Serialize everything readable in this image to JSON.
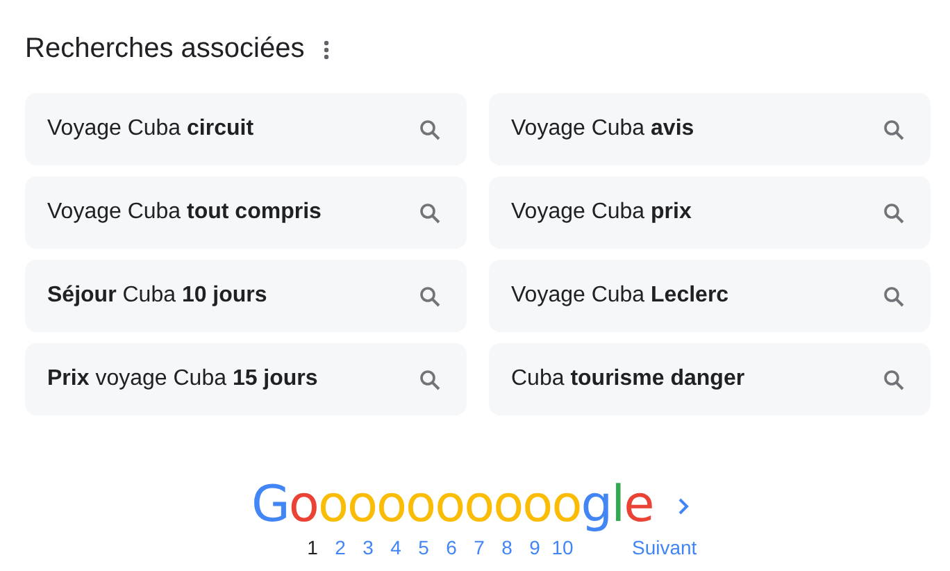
{
  "title": "Recherches associées",
  "suggestions": [
    {
      "text": "Voyage Cuba **circuit**"
    },
    {
      "text": "Voyage Cuba **avis**"
    },
    {
      "text": "Voyage Cuba **tout compris**"
    },
    {
      "text": "Voyage Cuba **prix**"
    },
    {
      "text": "**Séjour** Cuba **10 jours**"
    },
    {
      "text": "Voyage Cuba **Leclerc**"
    },
    {
      "text": "**Prix** voyage Cuba **15 jours**"
    },
    {
      "text": "Cuba **tourisme danger**"
    }
  ],
  "pagination": {
    "logo": [
      {
        "text": "G",
        "color": "#4285f4"
      },
      {
        "text": "o",
        "color": "#ea4335"
      },
      {
        "text": "o",
        "color": "#fbbc05"
      },
      {
        "text": "o",
        "color": "#fbbc05"
      },
      {
        "text": "o",
        "color": "#fbbc05"
      },
      {
        "text": "o",
        "color": "#fbbc05"
      },
      {
        "text": "o",
        "color": "#fbbc05"
      },
      {
        "text": "o",
        "color": "#fbbc05"
      },
      {
        "text": "o",
        "color": "#fbbc05"
      },
      {
        "text": "o",
        "color": "#fbbc05"
      },
      {
        "text": "o",
        "color": "#fbbc05"
      },
      {
        "text": "g",
        "color": "#4285f4"
      },
      {
        "text": "l",
        "color": "#34a853"
      },
      {
        "text": "e",
        "color": "#ea4335"
      }
    ],
    "pages": [
      {
        "label": "1",
        "selected": true
      },
      {
        "label": "2",
        "selected": false
      },
      {
        "label": "3",
        "selected": false
      },
      {
        "label": "4",
        "selected": false
      },
      {
        "label": "5",
        "selected": false
      },
      {
        "label": "6",
        "selected": false
      },
      {
        "label": "7",
        "selected": false
      },
      {
        "label": "8",
        "selected": false
      },
      {
        "label": "9",
        "selected": false
      },
      {
        "label": "10",
        "selected": false
      }
    ],
    "next": "Suivant"
  }
}
